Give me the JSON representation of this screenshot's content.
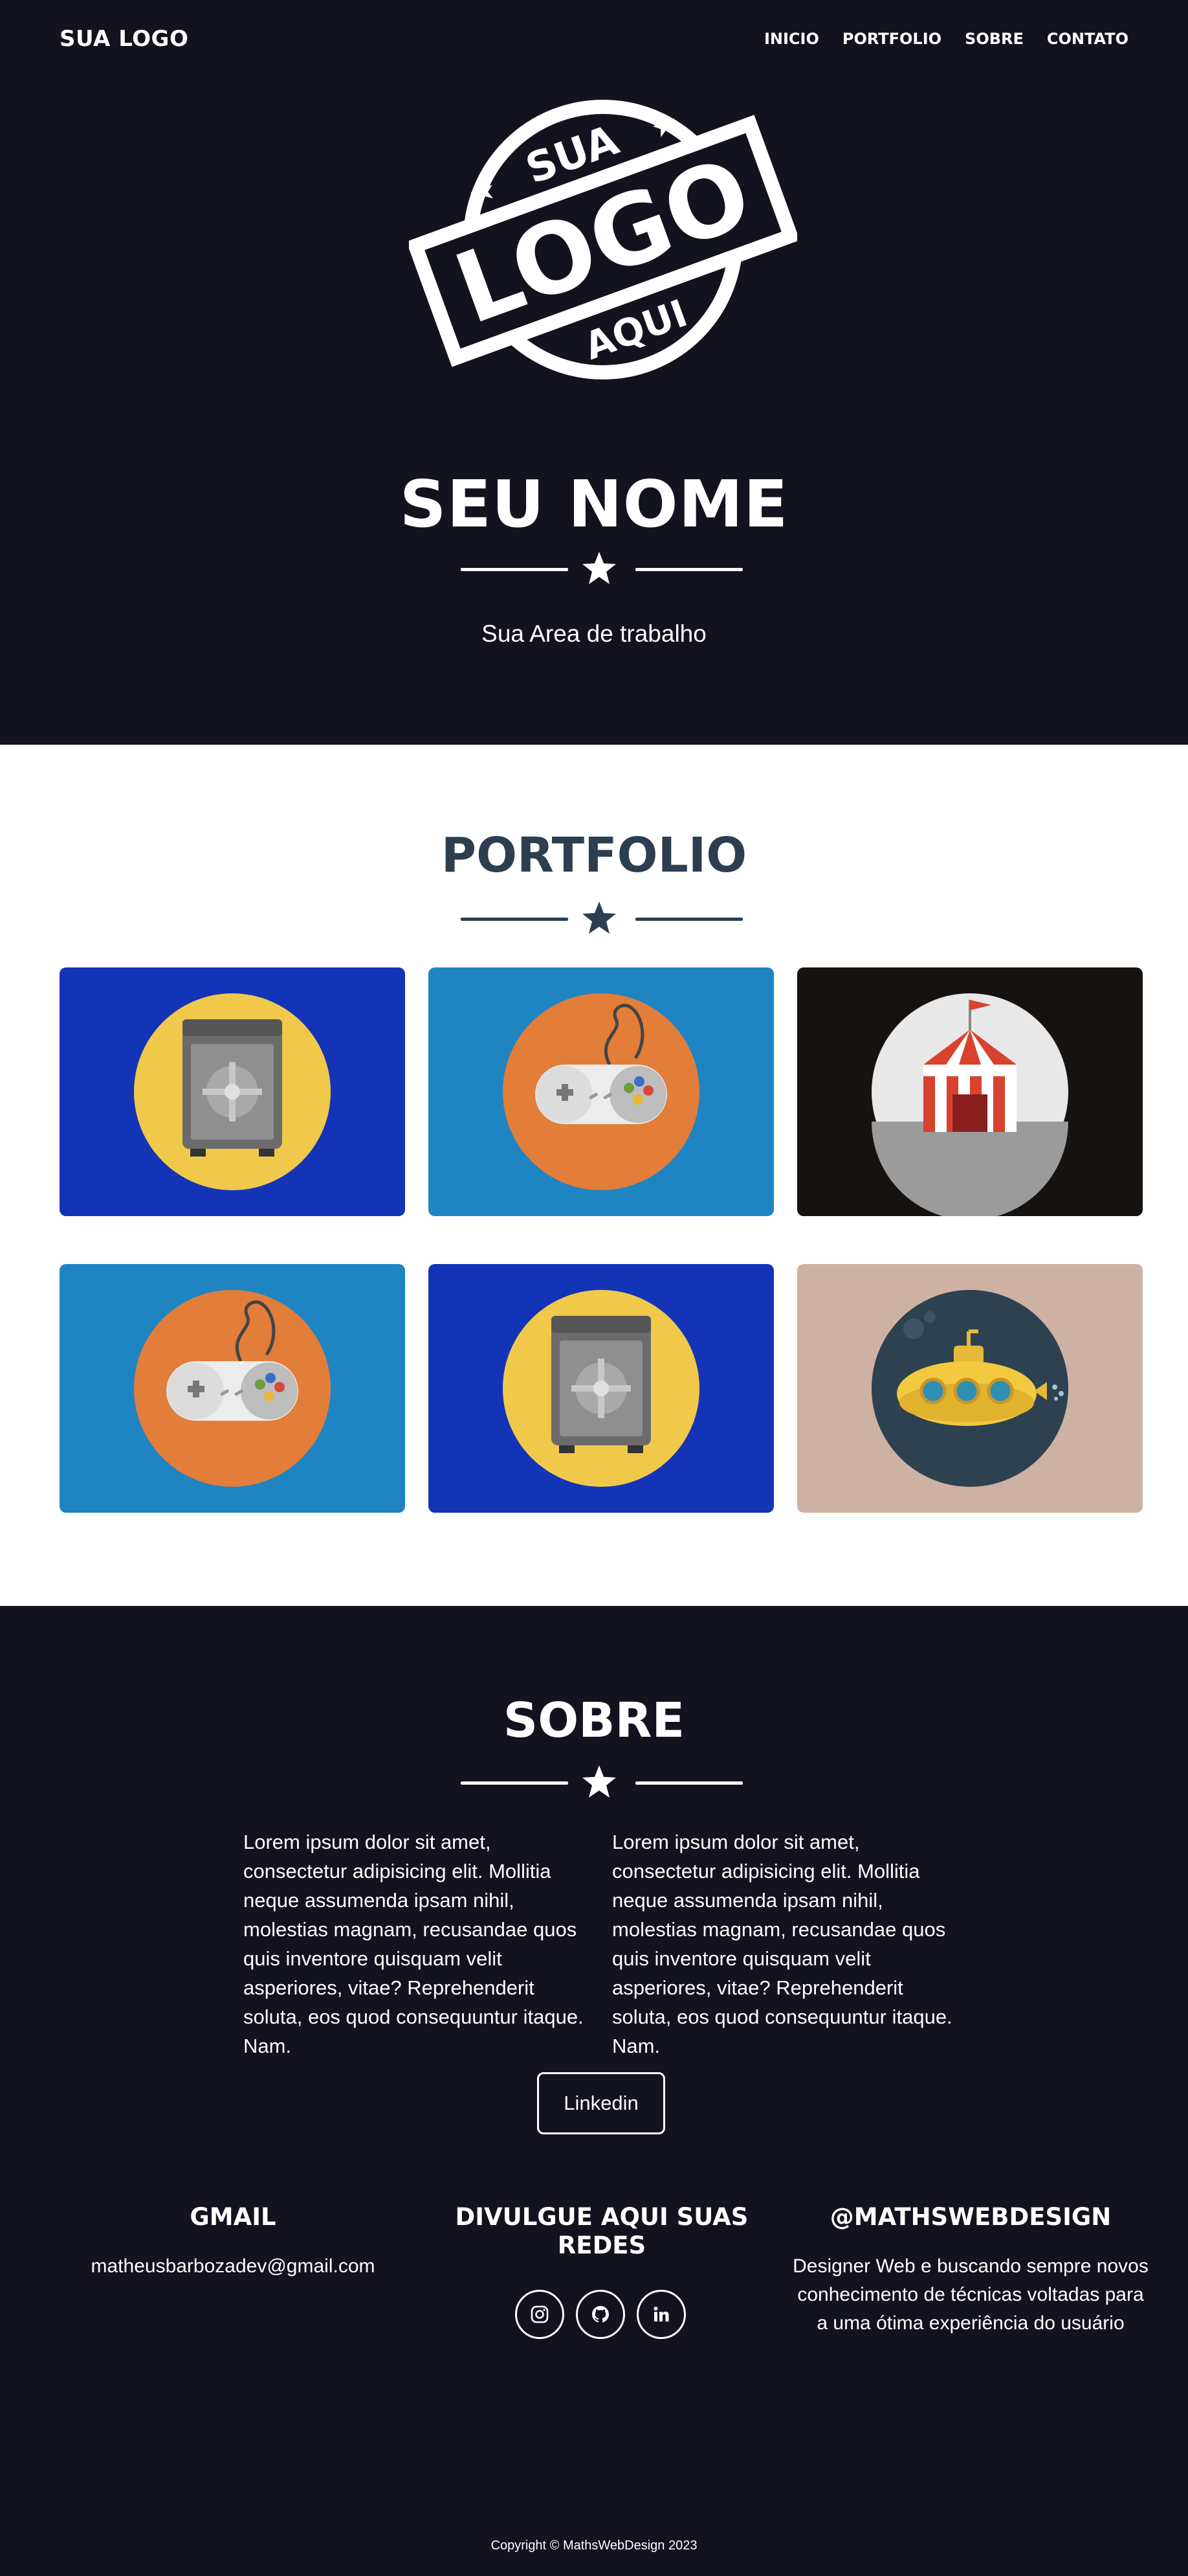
{
  "nav": {
    "brand": "SUA LOGO",
    "links": [
      "INICIO",
      "PORTFOLIO",
      "SOBRE",
      "CONTATO"
    ]
  },
  "hero": {
    "logo_text_top": "SUA",
    "logo_text_middle": "LOGO",
    "logo_text_bottom": "AQUI",
    "name": "SEU NOME",
    "subtitle": "Sua Area de trabalho"
  },
  "portfolio": {
    "title": "PORTFOLIO",
    "items": [
      {
        "icon": "safe-icon",
        "bg": "#1434b8",
        "circle": "#f0c94a"
      },
      {
        "icon": "gamepad-icon",
        "bg": "#1f84c2",
        "circle": "#e27d3a"
      },
      {
        "icon": "circus-tent-icon",
        "bg": "#16120f",
        "circle": "#e8e8e8"
      },
      {
        "icon": "gamepad-icon",
        "bg": "#1f84c2",
        "circle": "#e27d3a"
      },
      {
        "icon": "safe-icon",
        "bg": "#1434b8",
        "circle": "#f0c94a"
      },
      {
        "icon": "submarine-icon",
        "bg": "#cdb1a2",
        "circle": "#2d4150"
      }
    ]
  },
  "sobre": {
    "title": "SOBRE",
    "col1": "Lorem ipsum dolor sit amet, consectetur adipisicing elit. Mollitia neque assumenda ipsam nihil, molestias magnam, recusandae quos quis inventore quisquam velit asperiores, vitae? Reprehenderit soluta, eos quod consequuntur itaque. Nam.",
    "col2": "Lorem ipsum dolor sit amet, consectetur adipisicing elit. Mollitia neque assumenda ipsam nihil, molestias magnam, recusandae quos quis inventore quisquam velit asperiores, vitae? Reprehenderit soluta, eos quod consequuntur itaque. Nam.",
    "button": "Linkedin"
  },
  "footer": {
    "gmail_title": "GMAIL",
    "gmail_value": "matheusbarbozadev@gmail.com",
    "social_title": "DIVULGUE AQUI SUAS REDES",
    "social_icons": [
      "instagram-icon",
      "github-icon",
      "linkedin-icon"
    ],
    "handle_title": "@MATHSWEBDESIGN",
    "handle_text": "Designer Web e buscando sempre novos conhecimento de técnicas voltadas para a uma ótima experiência do usuário",
    "copyright": "Copyright © MathsWebDesign 2023"
  },
  "colors": {
    "dark": "#13121f",
    "navy_text": "#2c3e50",
    "white": "#ffffff"
  }
}
